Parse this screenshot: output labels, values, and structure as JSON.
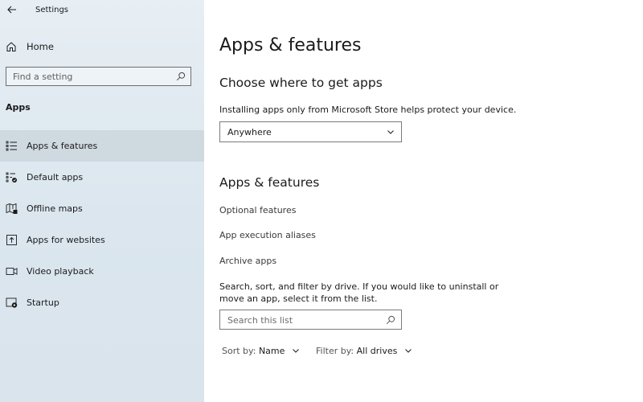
{
  "window": {
    "title": "Settings"
  },
  "sidebar": {
    "home_label": "Home",
    "search_placeholder": "Find a setting",
    "section": "Apps",
    "items": [
      {
        "label": "Apps & features",
        "icon": "list-icon",
        "selected": true
      },
      {
        "label": "Default apps",
        "icon": "default-apps-icon",
        "selected": false
      },
      {
        "label": "Offline maps",
        "icon": "map-icon",
        "selected": false
      },
      {
        "label": "Apps for websites",
        "icon": "open-in-app-icon",
        "selected": false
      },
      {
        "label": "Video playback",
        "icon": "video-icon",
        "selected": false
      },
      {
        "label": "Startup",
        "icon": "startup-icon",
        "selected": false
      }
    ]
  },
  "main": {
    "title": "Apps & features",
    "get_apps": {
      "heading": "Choose where to get apps",
      "description": "Installing apps only from Microsoft Store helps protect your device.",
      "dropdown_value": "Anywhere"
    },
    "features": {
      "heading": "Apps & features",
      "links": [
        "Optional features",
        "App execution aliases",
        "Archive apps"
      ],
      "description": "Search, sort, and filter by drive. If you would like to uninstall or move an app, select it from the list.",
      "search_placeholder": "Search this list",
      "sort_prefix": "Sort by:",
      "sort_value": "Name",
      "filter_prefix": "Filter by:",
      "filter_value": "All drives"
    }
  },
  "colors": {
    "sidebar_bg": "#dde7ee",
    "selected_bg": "#cfd9e0",
    "text": "#1b1b1b"
  }
}
